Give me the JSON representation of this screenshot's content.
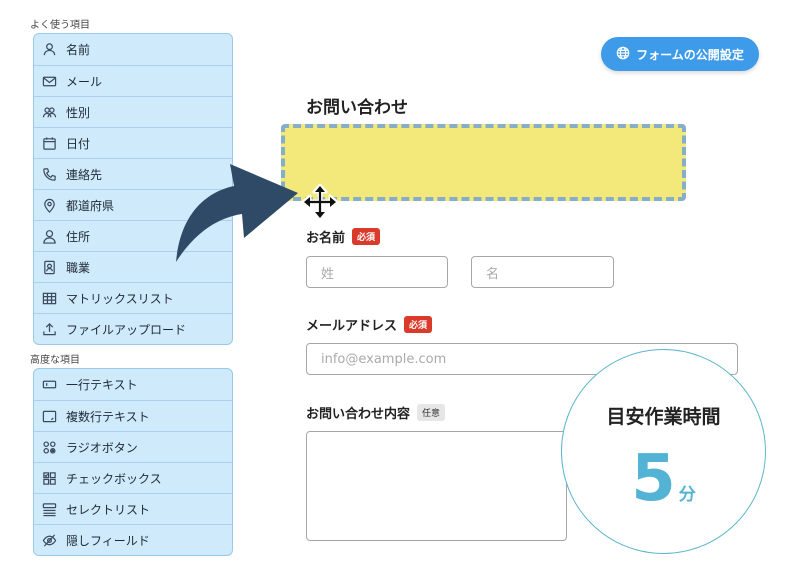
{
  "sidebar": {
    "common_label": "よく使う項目",
    "common_items": [
      {
        "label": "名前",
        "icon": "person-icon"
      },
      {
        "label": "メール",
        "icon": "envelope-icon"
      },
      {
        "label": "性別",
        "icon": "people-icon"
      },
      {
        "label": "日付",
        "icon": "calendar-icon"
      },
      {
        "label": "連絡先",
        "icon": "phone-icon"
      },
      {
        "label": "都道府県",
        "icon": "map-pin-icon"
      },
      {
        "label": "住所",
        "icon": "person-outline-icon"
      },
      {
        "label": "職業",
        "icon": "id-card-icon"
      },
      {
        "label": "マトリックスリスト",
        "icon": "table-icon"
      },
      {
        "label": "ファイルアップロード",
        "icon": "upload-icon"
      }
    ],
    "advanced_label": "高度な項目",
    "advanced_items": [
      {
        "label": "一行テキスト",
        "icon": "single-line-text-icon"
      },
      {
        "label": "複数行テキスト",
        "icon": "multi-line-text-icon"
      },
      {
        "label": "ラジオボタン",
        "icon": "radio-button-icon"
      },
      {
        "label": "チェックボックス",
        "icon": "checkbox-icon"
      },
      {
        "label": "セレクトリスト",
        "icon": "select-list-icon"
      },
      {
        "label": "隠しフィールド",
        "icon": "eye-slash-icon"
      }
    ]
  },
  "header": {
    "publish_button": "フォームの公開設定",
    "publish_icon": "globe-icon"
  },
  "form": {
    "title": "お問い合わせ",
    "name": {
      "label": "お名前",
      "badge": "必須",
      "last_placeholder": "姓",
      "first_placeholder": "名"
    },
    "email": {
      "label": "メールアドレス",
      "badge": "必須",
      "placeholder": "info@example.com"
    },
    "inquiry": {
      "label": "お問い合わせ内容",
      "badge": "任意"
    }
  },
  "estimate": {
    "label": "目安作業時間",
    "value": "5",
    "unit": "分"
  },
  "colors": {
    "sidebar_bg": "#cfeafb",
    "accent_blue": "#3d9bea",
    "dropzone_fill": "#f3e97a",
    "required_red": "#d93a2b",
    "estimate_number": "#53b3d4",
    "arrow": "#2f4a66"
  }
}
